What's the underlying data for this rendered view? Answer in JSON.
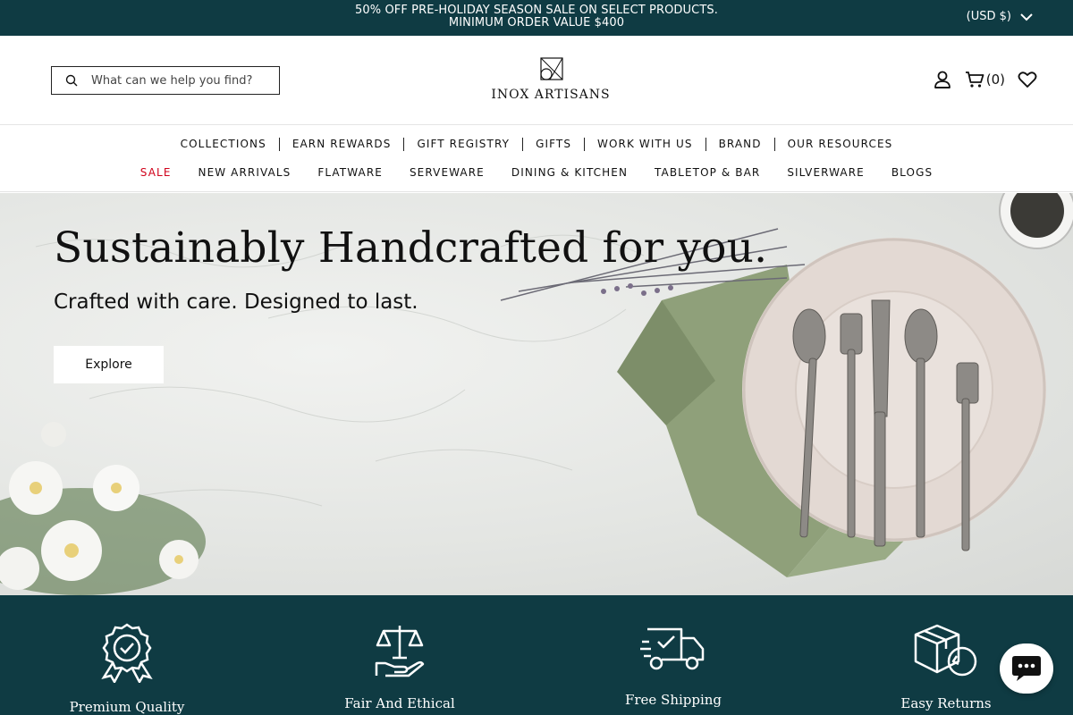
{
  "announcement": {
    "text": "50% OFF PRE-HOLIDAY SEASON SALE ON SELECT PRODUCTS. MINIMUM ORDER VALUE $400",
    "currency": "(USD $)"
  },
  "header": {
    "search_placeholder": "What can we help you find?",
    "logo_text": "INOX ARTISANS",
    "cart_count": "(0)"
  },
  "nav": {
    "row1": [
      "COLLECTIONS",
      "EARN REWARDS",
      "GIFT REGISTRY",
      "GIFTS",
      "WORK WITH US",
      "BRAND",
      "OUR RESOURCES"
    ],
    "row2": [
      "SALE",
      "NEW ARRIVALS",
      "FLATWARE",
      "SERVEWARE",
      "DINING & KITCHEN",
      "TABLETOP & BAR",
      "SILVERWARE",
      "BLOGS"
    ],
    "sale_color": "#d0021b"
  },
  "hero": {
    "title": "Sustainably Handcrafted for you.",
    "subtitle": "Crafted with care. Designed to last.",
    "button": "Explore"
  },
  "features": [
    {
      "label": "Premium Quality",
      "icon": "ribbon-badge-icon"
    },
    {
      "label": "Fair And Ethical",
      "icon": "hand-scale-icon"
    },
    {
      "label": "Free Shipping",
      "icon": "delivery-truck-icon"
    },
    {
      "label": "Easy Returns",
      "icon": "box-return-icon"
    }
  ],
  "colors": {
    "brand_dark": "#0f3b43",
    "sale_red": "#d0021b"
  }
}
